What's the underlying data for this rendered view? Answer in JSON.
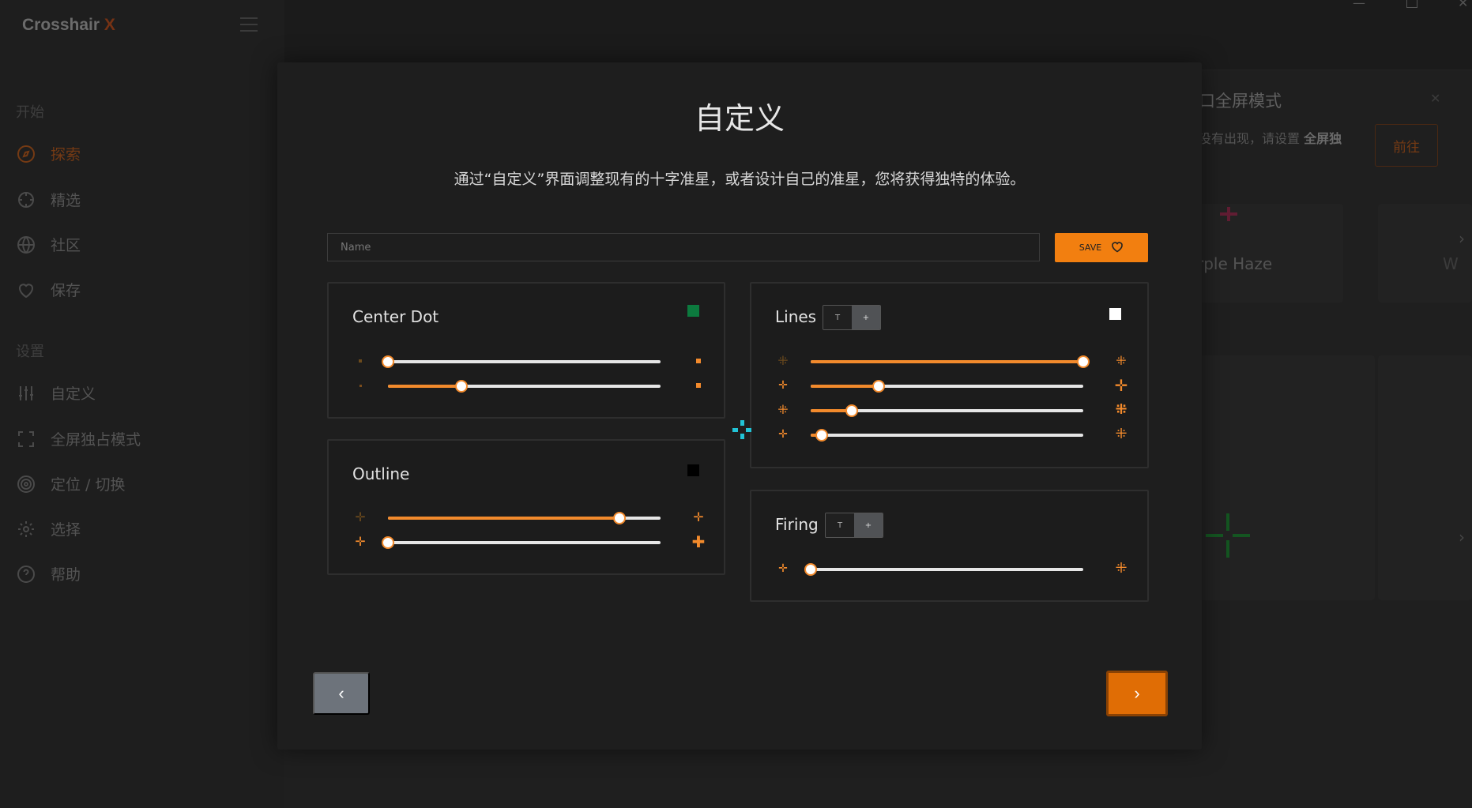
{
  "app": {
    "brand_name": "Crosshair",
    "brand_suffix": "X"
  },
  "sidebar": {
    "section_start": "开始",
    "section_settings": "设置",
    "items_start": [
      {
        "label": "探索",
        "icon": "compass-icon"
      },
      {
        "label": "精选",
        "icon": "crosshair-target-icon"
      },
      {
        "label": "社区",
        "icon": "globe-icon"
      },
      {
        "label": "保存",
        "icon": "heart-icon"
      }
    ],
    "items_settings": [
      {
        "label": "自定义",
        "icon": "sliders-icon"
      },
      {
        "label": "全屏独占模式",
        "icon": "fullscreen-icon"
      },
      {
        "label": "定位 / 切换",
        "icon": "target-icon"
      },
      {
        "label": "选择",
        "icon": "gear-icon"
      },
      {
        "label": "帮助",
        "icon": "help-circle-icon"
      }
    ]
  },
  "background": {
    "banner_title": "口全屏模式",
    "banner_text_prefix": "没有出现，请设置 ",
    "banner_text_bold": "全屏独",
    "banner_button": "前往",
    "card_name": "rple Haze",
    "card_name_2": "W"
  },
  "modal": {
    "title": "自定义",
    "description": "通过“自定义”界面调整现有的十字准星，或者设计自己的准星，您将获得独特的体验。",
    "name_placeholder": "Name",
    "name_value": "",
    "save_label": "SAVE",
    "center_dot": {
      "title": "Center Dot",
      "color": "#0c7a3e",
      "sliders": [
        0.0,
        0.27
      ]
    },
    "outline": {
      "title": "Outline",
      "color": "#000000",
      "sliders": [
        0.85,
        0.0
      ]
    },
    "lines": {
      "title": "Lines",
      "color": "#ffffff",
      "toggle": [
        "T",
        "+"
      ],
      "sliders": [
        1.0,
        0.25,
        0.15,
        0.04
      ]
    },
    "firing": {
      "title": "Firing",
      "toggle": [
        "T",
        "+"
      ],
      "sliders": [
        0.0
      ]
    },
    "preview_color": "#22c3d6",
    "prev_label": "‹",
    "next_label": "›"
  }
}
